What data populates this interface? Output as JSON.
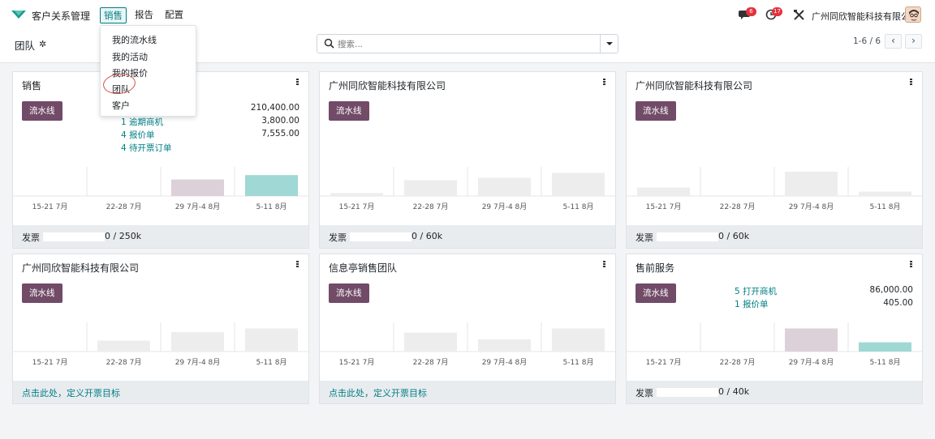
{
  "app": {
    "name": "客户关系管理"
  },
  "menus": {
    "sales": "销售",
    "report": "报告",
    "config": "配置"
  },
  "system": {
    "messages_count": "6",
    "activities_count": "17",
    "company": "广州同欣智能科技有限公司"
  },
  "control": {
    "breadcrumb": "团队",
    "search_placeholder": "搜索...",
    "pager": "1-6 / 6",
    "prev": "‹",
    "next": "›"
  },
  "dropdown": {
    "items": [
      "我的流水线",
      "我的活动",
      "我的报价",
      "团队",
      "客户"
    ]
  },
  "colors": {
    "accent": "#017e84",
    "pipeline": "#714b67",
    "bar_grey": "#ededed",
    "bar_pink": "#dcd1d9",
    "bar_teal": "#9fd8d4"
  },
  "chart_categories": [
    "15-21 7月",
    "22-28 7月",
    "29 7月-4 8月",
    "5-11 8月"
  ],
  "cards": [
    {
      "title": "销售",
      "button": "流水线",
      "stats": [
        {
          "label": "",
          "value": "210,400.00"
        },
        {
          "label": "1 逾期商机",
          "value": "3,800.00"
        },
        {
          "label": "4 报价单",
          "value": "7,555.00"
        },
        {
          "label": "4 待开票订单",
          "value": ""
        }
      ],
      "bars": [
        0,
        0,
        0.68,
        0.86
      ],
      "bar_colors": [
        "grey",
        "grey",
        "pink",
        "teal"
      ],
      "footer": {
        "label": "发票",
        "value": "0 /  250k"
      }
    },
    {
      "title": "广州同欣智能科技有限公司",
      "button": "流水线",
      "stats": [],
      "bars": [
        0.12,
        0.65,
        0.75,
        0.95
      ],
      "bar_colors": [
        "grey",
        "grey",
        "grey",
        "grey"
      ],
      "footer": {
        "label": "发票",
        "value": "0 /  60k"
      }
    },
    {
      "title": "广州同欣智能科技有限公司",
      "button": "流水线",
      "stats": [],
      "bars": [
        0.35,
        0,
        1.0,
        0.18
      ],
      "bar_colors": [
        "grey",
        "grey",
        "grey",
        "grey"
      ],
      "footer": {
        "label": "发票",
        "value": "0 /  60k"
      }
    },
    {
      "title": "广州同欣智能科技有限公司",
      "button": "流水线",
      "stats": [],
      "bars": [
        0,
        0.45,
        0.8,
        0.95
      ],
      "bar_colors": [
        "grey",
        "grey",
        "grey",
        "grey"
      ],
      "footer": {
        "link": "点击此处，定义开票目标"
      }
    },
    {
      "title": "信息亭销售团队",
      "button": "流水线",
      "stats": [],
      "bars": [
        0,
        0.78,
        0.5,
        0.95
      ],
      "bar_colors": [
        "grey",
        "grey",
        "grey",
        "grey"
      ],
      "footer": {
        "link": "点击此处，定义开票目标"
      }
    },
    {
      "title": "售前服务",
      "button": "流水线",
      "stats": [
        {
          "label": "5 打开商机",
          "value": "86,000.00"
        },
        {
          "label": "1 报价单",
          "value": "405.00"
        }
      ],
      "bars": [
        0,
        0,
        0.95,
        0.38
      ],
      "bar_colors": [
        "grey",
        "grey",
        "pink",
        "teal"
      ],
      "footer": {
        "label": "发票",
        "value": "0 /  40k"
      }
    }
  ]
}
